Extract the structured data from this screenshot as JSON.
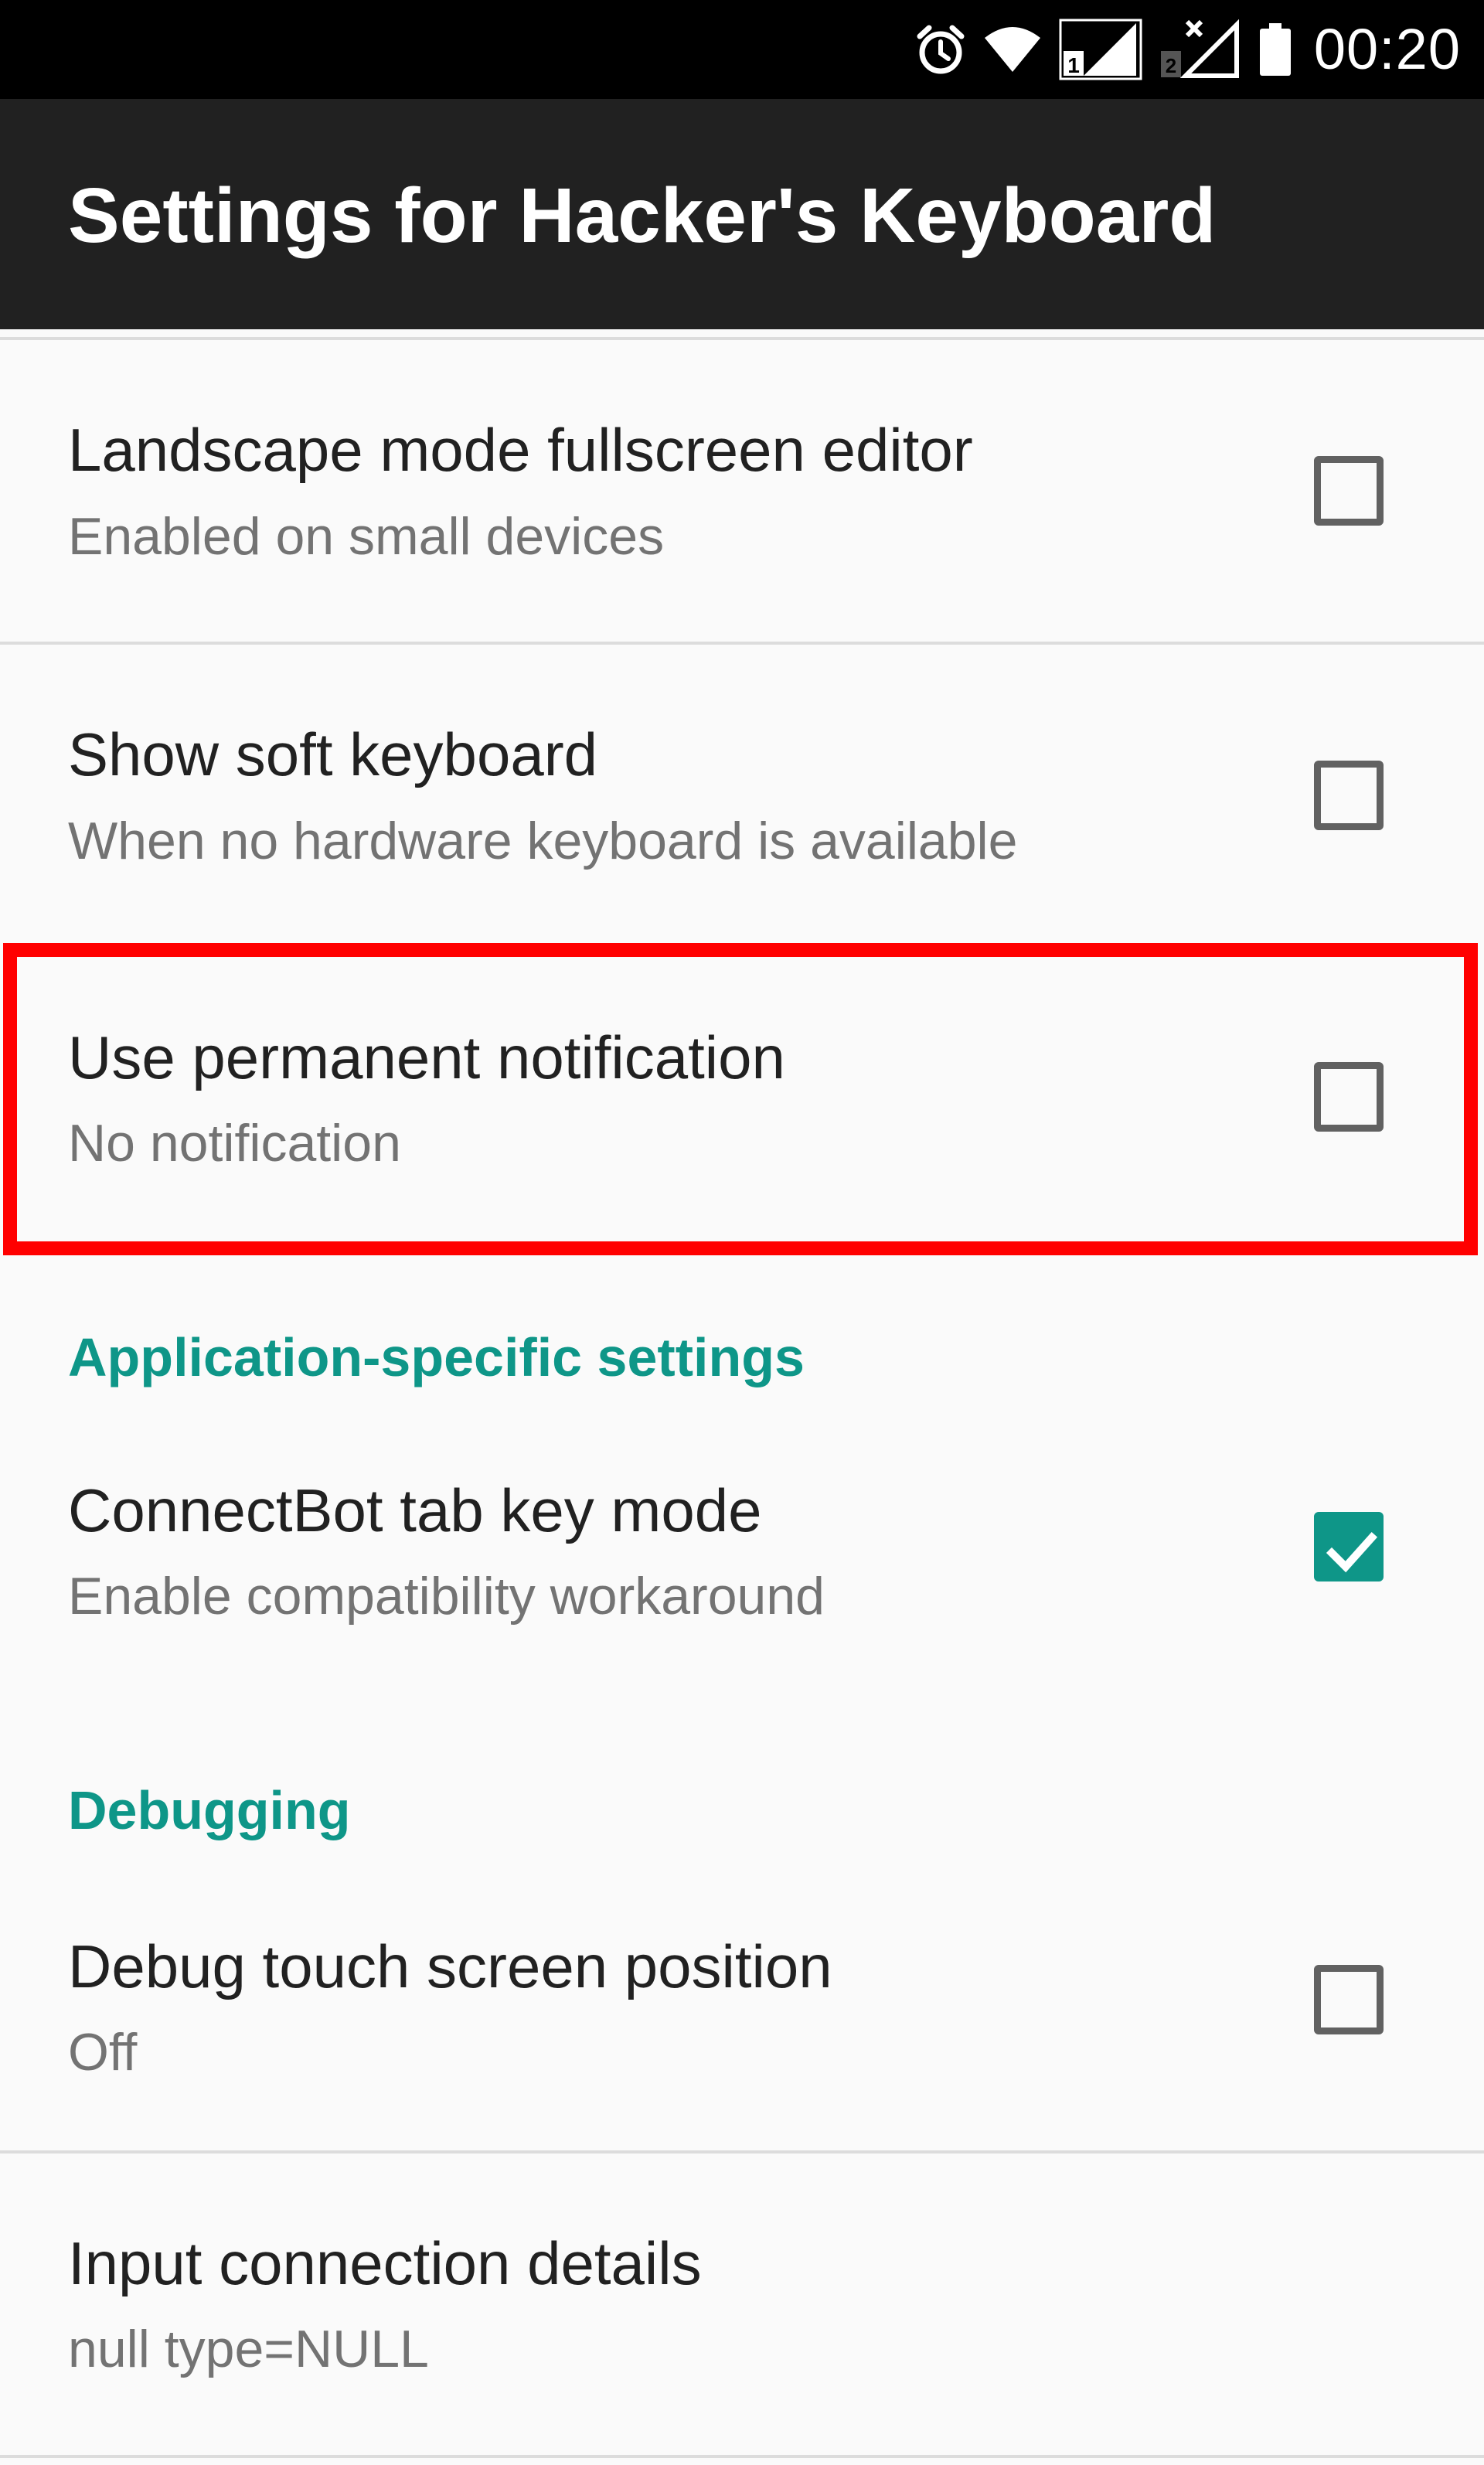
{
  "status_bar": {
    "time": "00:20",
    "icons": [
      "alarm-icon",
      "wifi-icon",
      "signal-sim1-icon",
      "signal-sim2-no-service-icon",
      "battery-icon"
    ],
    "sim1_label": "1",
    "sim2_label": "2"
  },
  "app_bar": {
    "title": "Settings for Hacker's Keyboard"
  },
  "preferences": [
    {
      "title": "Landscape mode fullscreen editor",
      "summary": "Enabled on small devices",
      "checked": false
    },
    {
      "title": "Show soft keyboard",
      "summary": "When no hardware keyboard is available",
      "checked": false
    },
    {
      "title": "Use permanent notification",
      "summary": "No notification",
      "checked": false,
      "highlighted": true
    }
  ],
  "categories": {
    "app_specific": {
      "title": "Application-specific settings",
      "items": [
        {
          "title": "ConnectBot tab key mode",
          "summary": "Enable compatibility workaround",
          "checked": true
        }
      ]
    },
    "debugging": {
      "title": "Debugging",
      "items": [
        {
          "title": "Debug touch screen position",
          "summary": "Off",
          "checked": false
        },
        {
          "title": "Input connection details",
          "summary": "null type=NULL"
        }
      ]
    }
  },
  "colors": {
    "accent": "#0e9688",
    "highlight": "#ff0000",
    "app_bar": "#212121",
    "background": "#fafafa"
  }
}
